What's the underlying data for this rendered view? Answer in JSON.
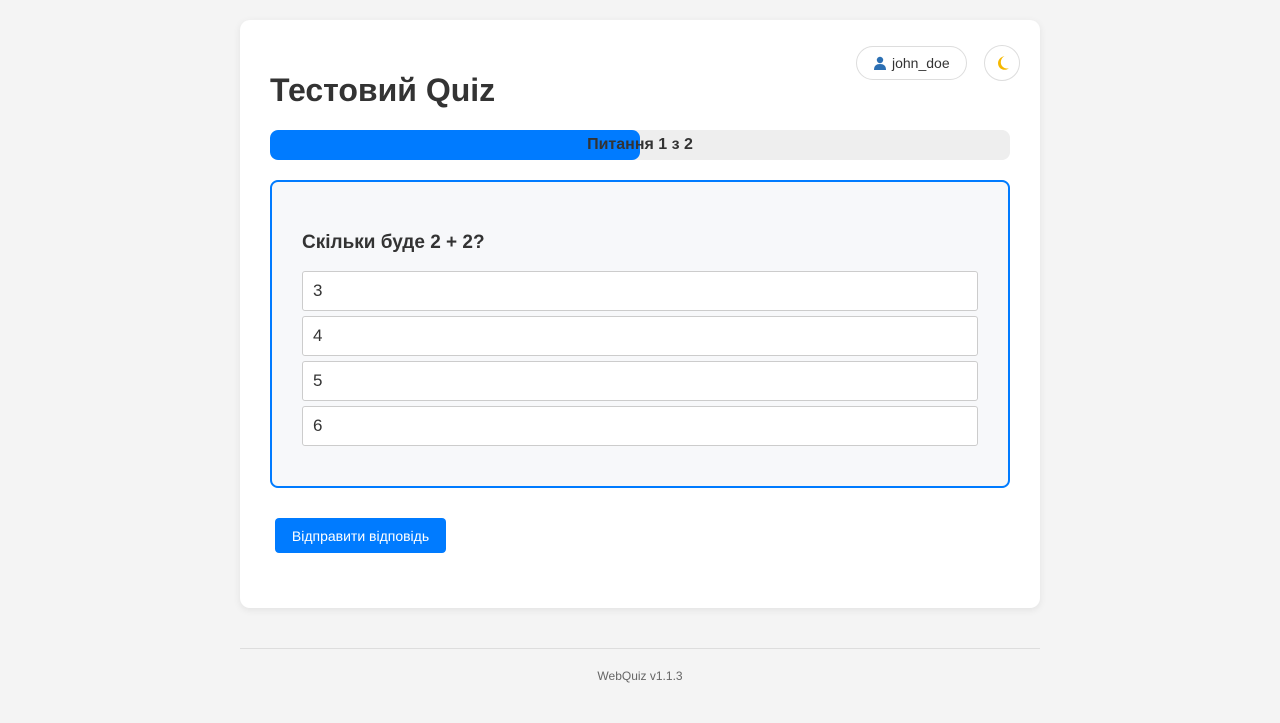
{
  "header": {
    "username": "john_doe",
    "user_icon": "user-icon",
    "theme_icon": "moon-icon",
    "title": "Тестовий Quiz"
  },
  "progress": {
    "label": "Питання 1 з 2",
    "current": 1,
    "total": 2,
    "fraction": 0.5,
    "fill_color": "#007bff"
  },
  "question": {
    "text": "Скільки буде 2 + 2?",
    "options": [
      "3",
      "4",
      "5",
      "6"
    ]
  },
  "actions": {
    "submit_label": "Відправити відповідь"
  },
  "footer": {
    "version": "WebQuiz v1.1.3"
  },
  "colors": {
    "accent": "#007bff",
    "background": "#f4f4f4",
    "card": "#ffffff"
  }
}
